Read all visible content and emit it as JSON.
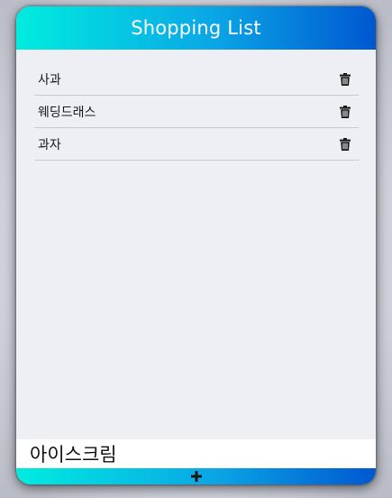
{
  "header": {
    "title": "Shopping List"
  },
  "items": [
    {
      "label": "사과"
    },
    {
      "label": "웨딩드래스"
    },
    {
      "label": "과자"
    }
  ],
  "input": {
    "value": "아이스크림"
  },
  "icons": {
    "delete": "trash-icon",
    "add": "plus-icon"
  },
  "colors": {
    "gradient_start": "#00ecdf",
    "gradient_end": "#0057d0",
    "list_background": "#eeeef5"
  }
}
